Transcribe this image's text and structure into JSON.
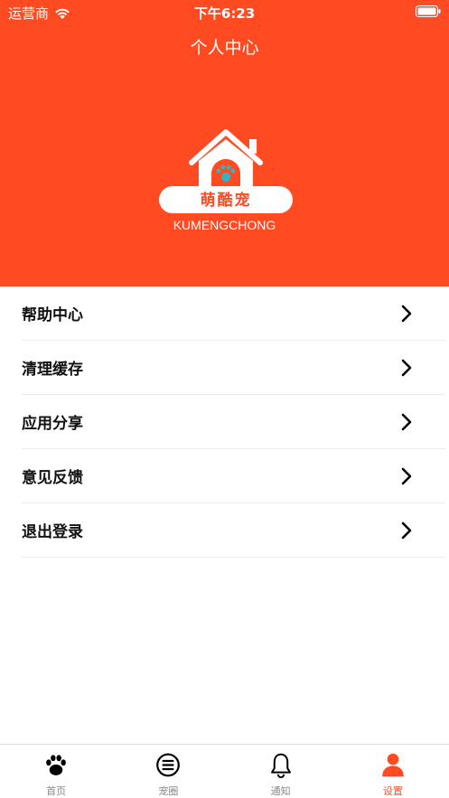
{
  "status_bar": {
    "carrier": "运营商",
    "time": "下午6:23"
  },
  "header": {
    "title": "个人中心"
  },
  "logo": {
    "name": "萌酷宠",
    "subtitle": "KUMENGCHONG"
  },
  "menu": {
    "items": [
      {
        "label": "帮助中心"
      },
      {
        "label": "清理缓存"
      },
      {
        "label": "应用分享"
      },
      {
        "label": "意见反馈"
      },
      {
        "label": "退出登录"
      }
    ]
  },
  "tabbar": {
    "items": [
      {
        "label": "首页",
        "icon": "paw-icon"
      },
      {
        "label": "宠圈",
        "icon": "list-circle-icon"
      },
      {
        "label": "通知",
        "icon": "bell-icon"
      },
      {
        "label": "设置",
        "icon": "person-icon",
        "active": true
      }
    ]
  },
  "colors": {
    "accent": "#ff4a22",
    "logo_paw": "#2bb7c9"
  }
}
